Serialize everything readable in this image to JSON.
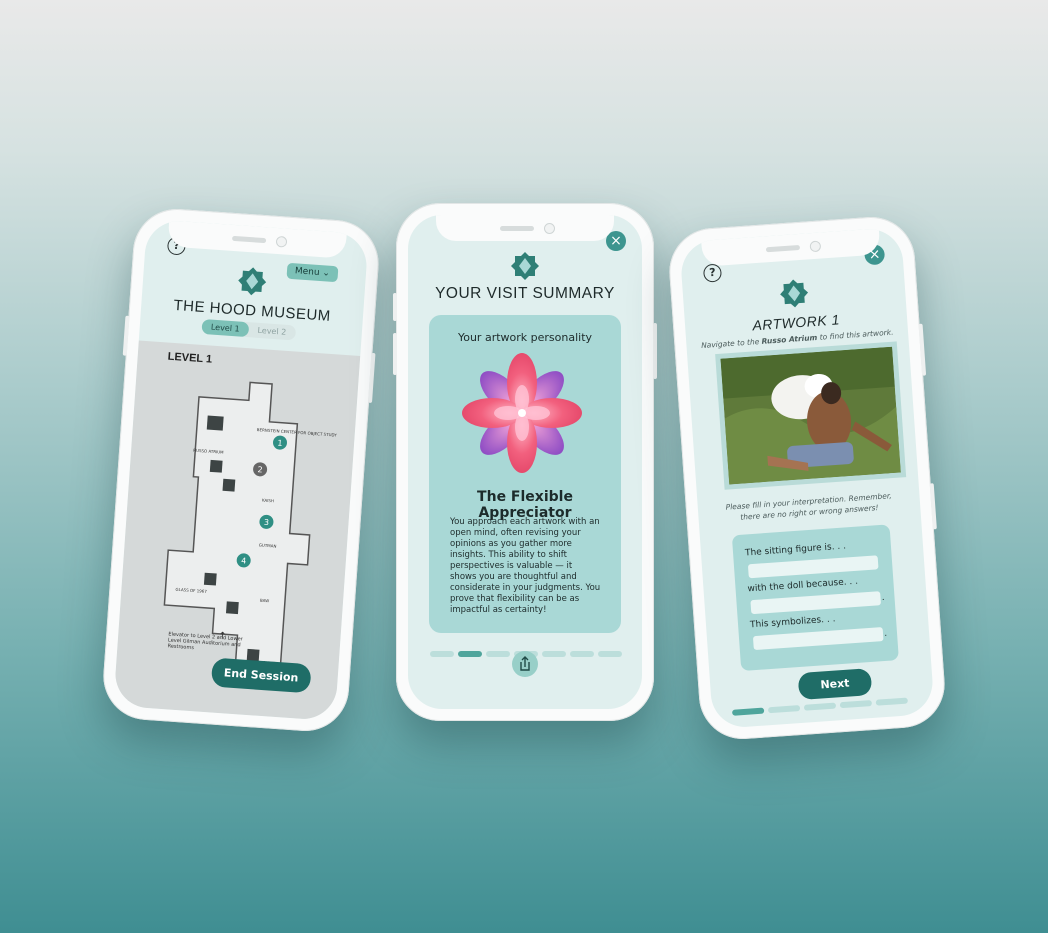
{
  "phone1": {
    "title": "THE HOOD MUSEUM",
    "menu_label": "Menu ⌄",
    "levels": [
      "Level 1",
      "Level 2"
    ],
    "map_heading": "LEVEL 1",
    "rooms": [
      "RUSSO ATRIUM",
      "BERNSTEIN CENTER FOR OBJECT STUDY",
      "KAISH",
      "GUTMAN",
      "GLASS OF 1967",
      "BAW",
      "ALBRIGHT"
    ],
    "markers": [
      "1",
      "2",
      "3",
      "4"
    ],
    "elevator_text": "Elevator to Level 2 and Lower Level Gilman Auditorium and Restrooms",
    "end_button": "End Session"
  },
  "phone2": {
    "title": "YOUR VISIT SUMMARY",
    "subtitle": "Your artwork personality",
    "personality": "The Flexible Appreciator",
    "description": "You approach each artwork with an open mind, often revising your opinions as you gather more insights. This ability to shift perspectives is valuable — it shows you are thoughtful and considerate in your judgments. You prove that flexibility can be as impactful as certainty!",
    "progress_step": 2,
    "progress_total": 7
  },
  "phone3": {
    "title": "ARTWORK 1",
    "nav_prefix": "Navigate to the ",
    "nav_location": "Russo Atrium",
    "nav_suffix": " to find this artwork.",
    "instruction": "Please fill in your interpretation. Remember, there are no right or wrong answers!",
    "q1": "The sitting figure is. . .",
    "q2": "with the doll because. . .",
    "q3": "This symbolizes. . .",
    "period": ".",
    "next_button": "Next",
    "progress_step": 1,
    "progress_total": 5
  },
  "colors": {
    "teal_dark": "#1f6d67",
    "teal_light": "#a9d8d6",
    "screen_bg": "#e0efee",
    "accent_pink": "#f05c7a",
    "accent_purple": "#9b59c8"
  }
}
